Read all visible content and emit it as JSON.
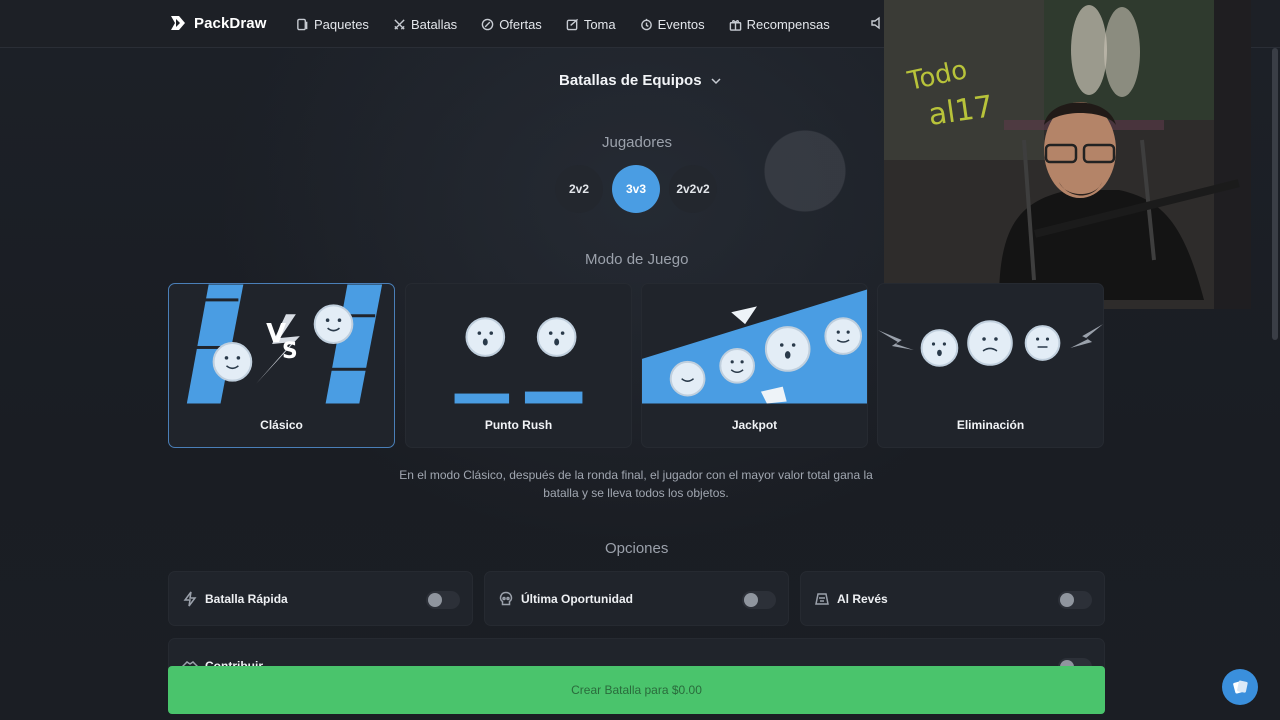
{
  "nav": {
    "brand": "PackDraw",
    "items": [
      {
        "label": "Paquetes",
        "icon": "packs-icon"
      },
      {
        "label": "Batallas",
        "icon": "swords-icon"
      },
      {
        "label": "Ofertas",
        "icon": "offers-icon"
      },
      {
        "label": "Toma",
        "icon": "draw-icon"
      },
      {
        "label": "Eventos",
        "icon": "events-icon"
      },
      {
        "label": "Recompensas",
        "icon": "gift-icon"
      }
    ]
  },
  "battle_type": {
    "label": "Batallas de Equipos"
  },
  "players": {
    "title": "Jugadores",
    "options": [
      "2v2",
      "3v3",
      "2v2v2"
    ],
    "selected": "3v3"
  },
  "mode": {
    "title": "Modo de Juego",
    "options": [
      "Clásico",
      "Punto Rush",
      "Jackpot",
      "Eliminación"
    ],
    "selected": "Clásico",
    "description": "En el modo Clásico, después de la ronda final, el jugador con el mayor valor total gana la batalla y se lleva todos los objetos."
  },
  "options": {
    "title": "Opciones",
    "items": [
      {
        "label": "Batalla Rápida",
        "icon": "bolt-icon",
        "enabled": false
      },
      {
        "label": "Última Oportunidad",
        "icon": "skull-icon",
        "enabled": false
      },
      {
        "label": "Al Revés",
        "icon": "reverse-icon",
        "enabled": false
      },
      {
        "label": "Contribuir",
        "icon": "handshake-icon",
        "enabled": false
      }
    ]
  },
  "create_button": {
    "label": "Crear Batalla para $0.00"
  },
  "colors": {
    "accent": "#4a9de3",
    "create": "#4ac46c",
    "background": "#1b1e24"
  }
}
